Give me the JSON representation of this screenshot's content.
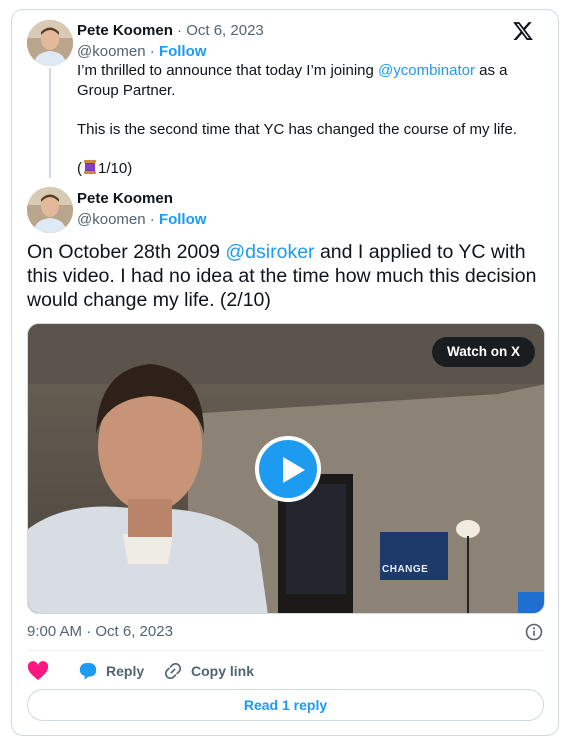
{
  "tweet1": {
    "name": "Pete Koomen",
    "separator": "·",
    "date": "Oct 6, 2023",
    "handle": "@koomen",
    "follow_label": "Follow",
    "text_before_mention": "I’m thrilled to announce that today I’m joining ",
    "mention": "@ycombinator",
    "text_after_mention": " as a Group Partner.",
    "paragraph2": "This is the second time that YC has changed the course of my life.",
    "thread_marker": "1/10)",
    "thread_marker_prefix": "(",
    "thread_emoji": "spool-of-thread-emoji"
  },
  "tweet2": {
    "name": "Pete Koomen",
    "handle": "@koomen",
    "follow_label": "Follow",
    "text_before_mention": "On October 28th 2009 ",
    "mention": "@dsiroker",
    "text_after_mention": " and I applied to YC with this video. I had no idea at the time how much this decision would change my life. (2/10)",
    "media": {
      "watch_label": "Watch on X",
      "poster_sign_text": "CHANGE",
      "play_icon": "play-icon"
    },
    "timestamp": "9:00 AM · Oct 6, 2023",
    "info_icon": "info-icon"
  },
  "actions": {
    "like_icon": "heart-icon",
    "reply_label": "Reply",
    "reply_icon": "reply-bubble-icon",
    "copy_label": "Copy link",
    "copy_icon": "link-icon"
  },
  "read_replies_label": "Read 1 reply",
  "colors": {
    "accent": "#1d9bf0",
    "like": "#f91880",
    "text": "#0f1419",
    "muted": "#536471",
    "border": "#cfd9de"
  }
}
